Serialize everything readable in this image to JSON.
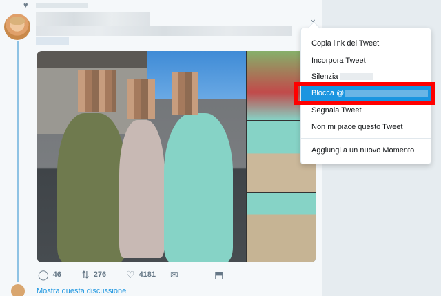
{
  "tweet": {
    "stats": {
      "replies": "46",
      "retweets": "276",
      "likes": "4181"
    },
    "show_thread_label": "Mostra questa discussione"
  },
  "menu": {
    "items": [
      {
        "label": "Copia link del Tweet"
      },
      {
        "label": "Incorpora Tweet"
      },
      {
        "label": "Silenzia"
      },
      {
        "label": "Blocca @"
      },
      {
        "label": "Segnala Tweet"
      },
      {
        "label": "Non mi piace questo Tweet"
      },
      {
        "label": "Aggiungi a un nuovo Momento"
      }
    ],
    "highlighted_item": "Blocca @"
  },
  "icons": {
    "heart": "heart-icon",
    "caret": "chevron-down-icon",
    "reply": "reply-icon",
    "retweet": "retweet-icon",
    "like": "like-icon",
    "dm": "envelope-icon",
    "save": "bookmark-icon"
  },
  "colors": {
    "accent": "#1b95e0",
    "highlight_border": "#ff0000",
    "thread_line": "#8fc3e4"
  }
}
